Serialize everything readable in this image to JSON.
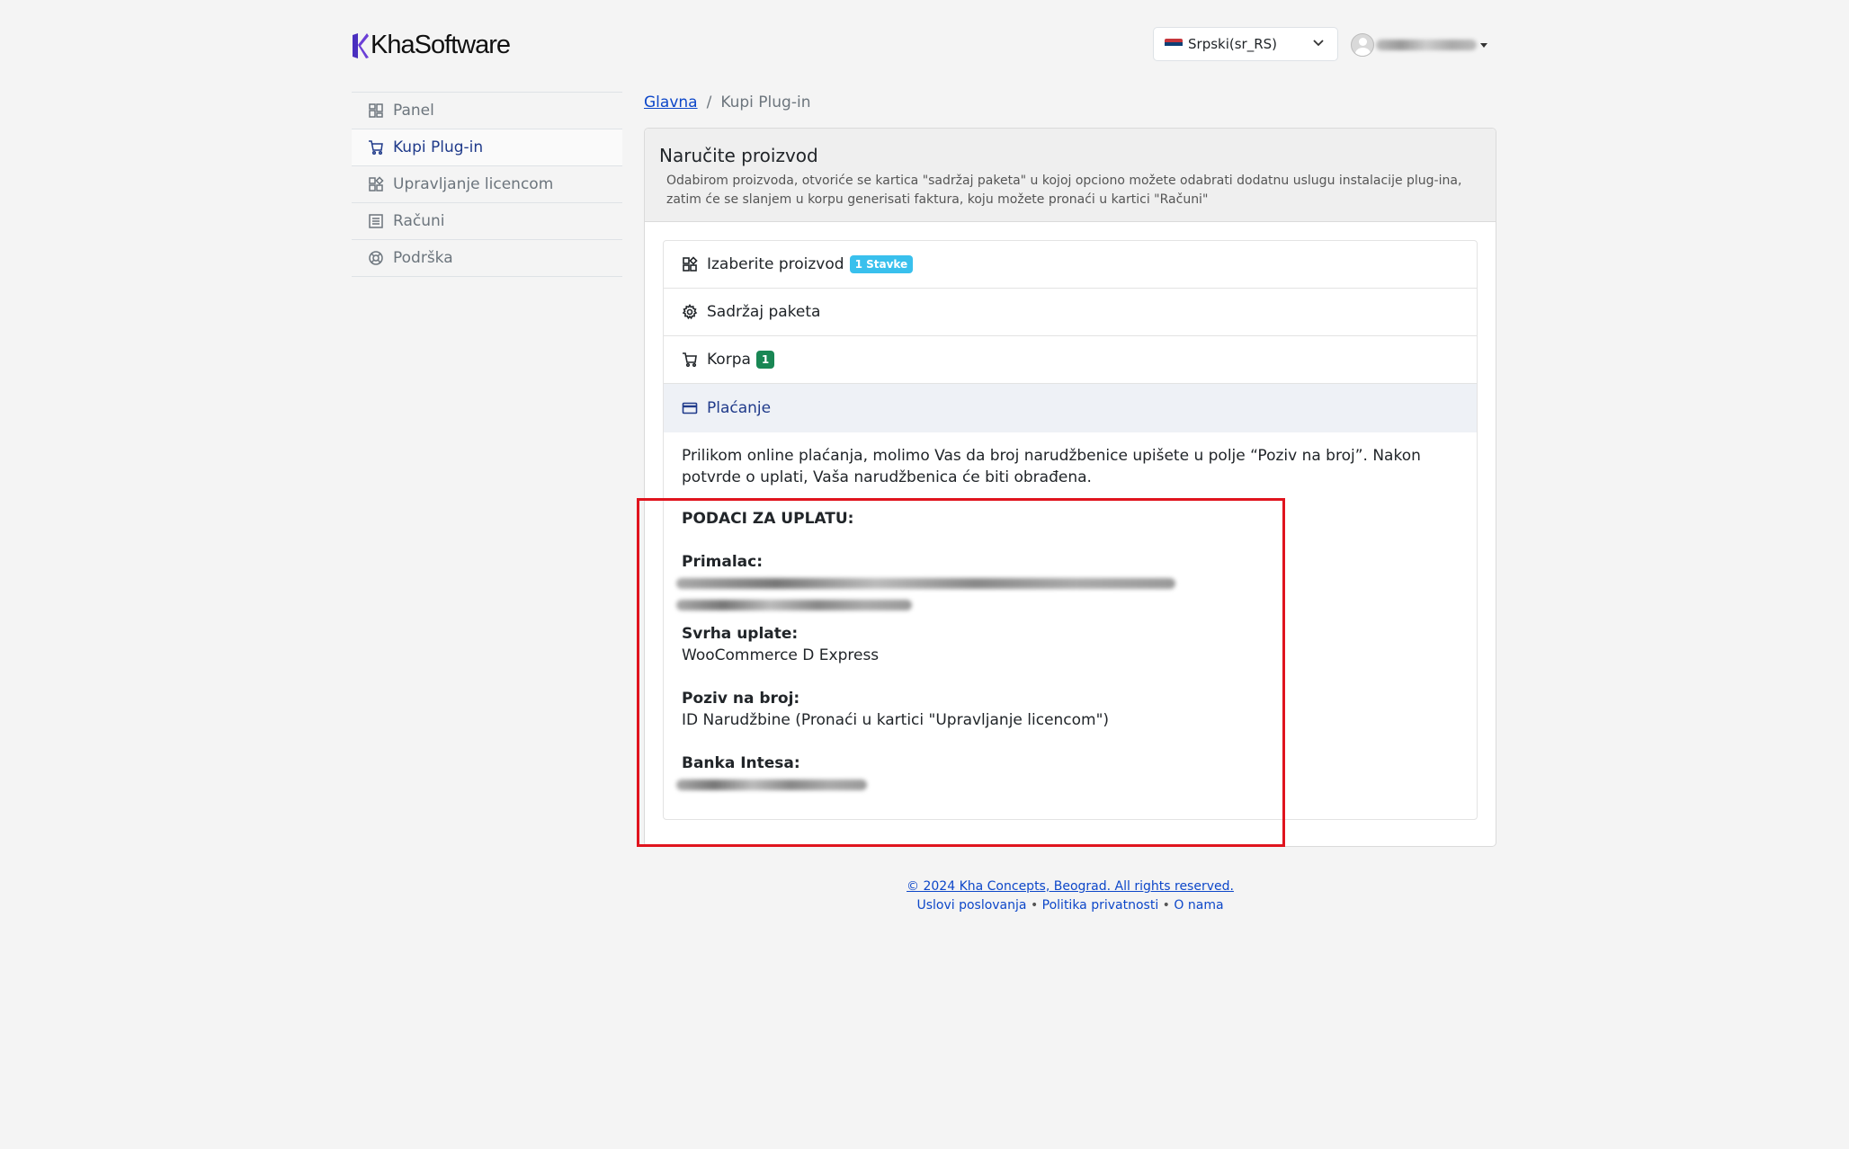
{
  "header": {
    "logo_text": "KhaSoftware",
    "language_select": {
      "value": "Srpski(sr_RS)"
    }
  },
  "sidebar": {
    "items": [
      {
        "label": "Panel",
        "icon": "grid-icon"
      },
      {
        "label": "Kupi Plug-in",
        "icon": "cart-icon",
        "active": true
      },
      {
        "label": "Upravljanje licencom",
        "icon": "apps-icon"
      },
      {
        "label": "Računi",
        "icon": "list-icon"
      },
      {
        "label": "Podrška",
        "icon": "support-icon"
      }
    ]
  },
  "breadcrumb": {
    "home": "Glavna",
    "current": "Kupi Plug-in"
  },
  "card": {
    "title": "Naručite proizvod",
    "subtitle": "Odabirom proizvoda, otvoriće se kartica \"sadržaj paketa\" u kojoj opciono možete odabrati dodatnu uslugu instalacije plug-ina, zatim će se slanjem u korpu generisati faktura, koju možete pronaći u kartici \"Računi\""
  },
  "accordion": {
    "items": [
      {
        "label": "Izaberite proizvod",
        "badge": "1 Stavke",
        "icon": "apps-icon"
      },
      {
        "label": "Sadržaj paketa",
        "icon": "gear-icon"
      },
      {
        "label": "Korpa",
        "badge": "1",
        "icon": "cart-icon"
      },
      {
        "label": "Plaćanje",
        "icon": "credit-card-icon"
      }
    ]
  },
  "payment": {
    "intro": "Prilikom online plaćanja, molimo Vas da broj narudžbenice upišete u polje “Poziv na broj”. Nakon potvrde o uplati, Vaša narudžbenica će biti obrađena.",
    "heading": "PODACI ZA UPLATU:",
    "recipient_label": "Primalac:",
    "purpose_label": "Svrha uplate:",
    "purpose_value": "WooCommerce D Express",
    "reference_label": "Poziv na broj:",
    "reference_value": "ID Narudžbine (Pronaći u kartici \"Upravljanje licencom\")",
    "bank_label": "Banka Intesa:"
  },
  "footer": {
    "copyright": "© 2024 Kha Concepts, Beograd. All rights reserved.",
    "links": [
      "Uslovi poslovanja",
      "Politika privatnosti",
      "O nama"
    ],
    "separator": "•"
  },
  "colors": {
    "accent": "#1f3a8a",
    "link": "#0d47c9",
    "badge_info": "#39c0ed",
    "badge_success": "#198754",
    "highlight": "#e0141e"
  }
}
